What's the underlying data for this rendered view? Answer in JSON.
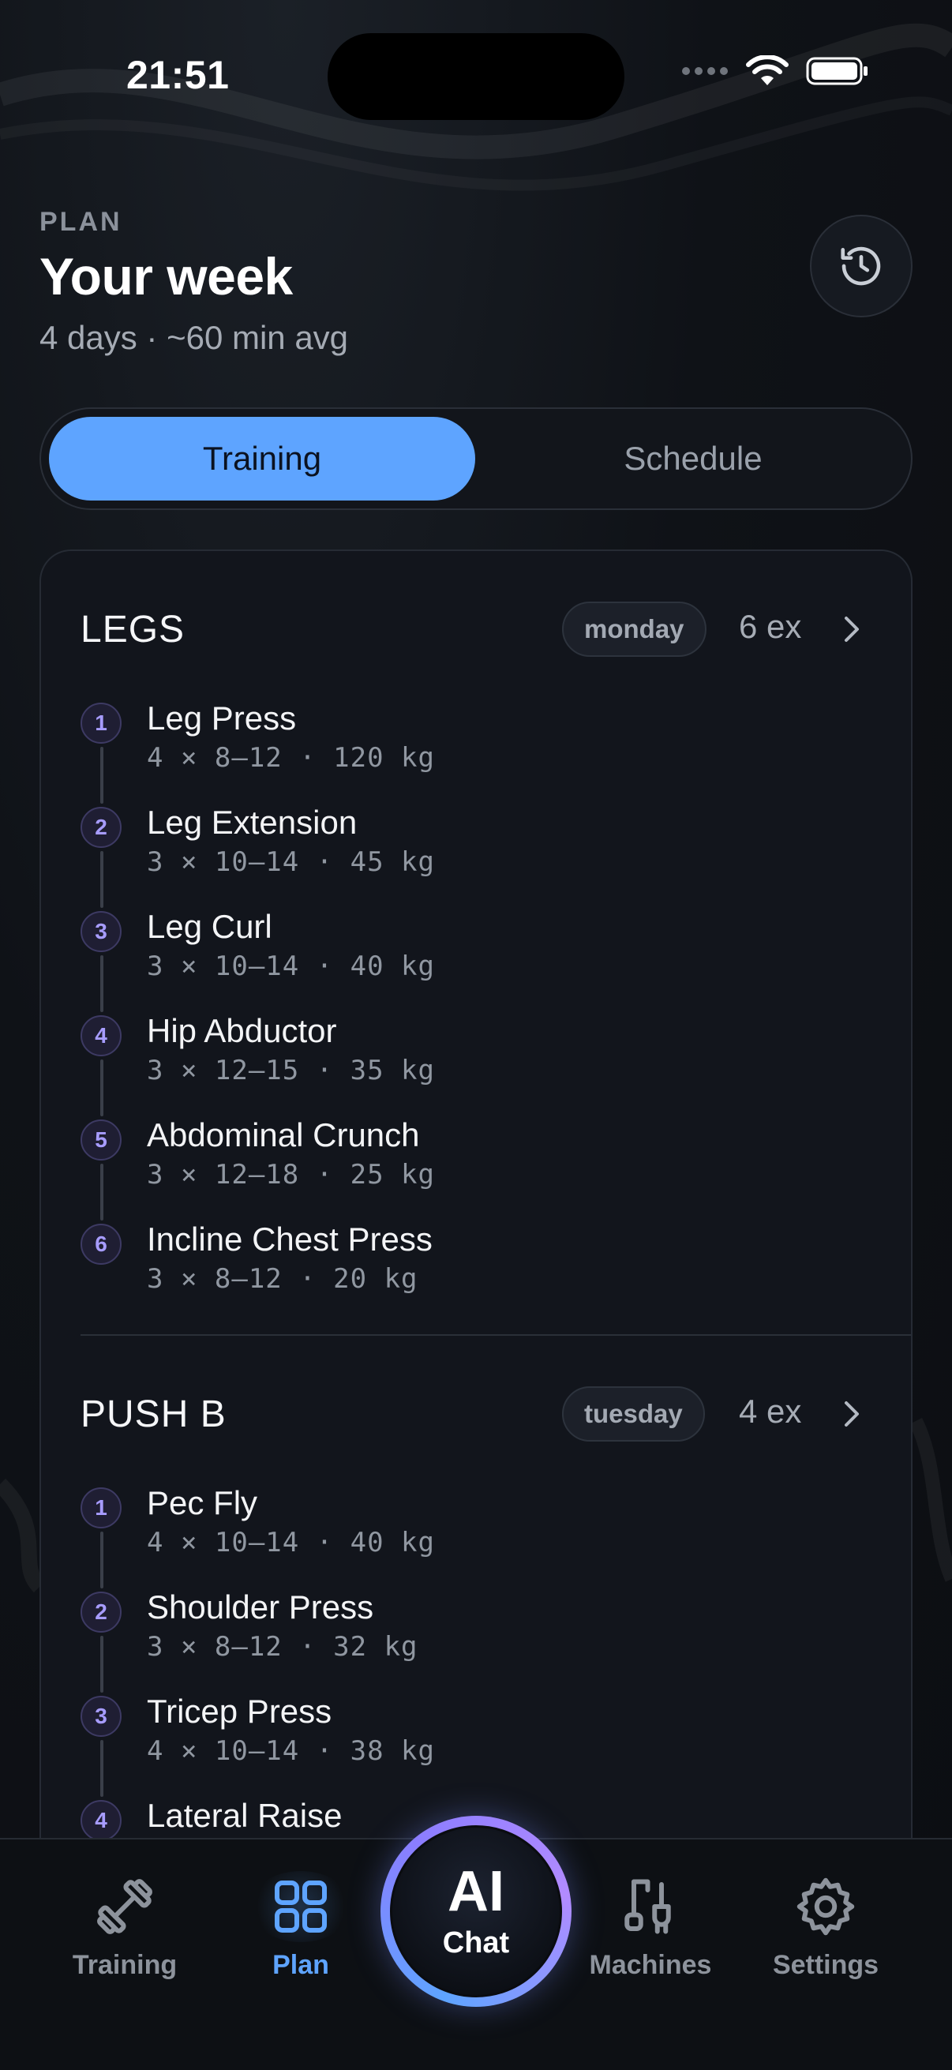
{
  "status": {
    "time": "21:51"
  },
  "header": {
    "eyebrow": "PLAN",
    "title": "Your week",
    "subtitle": "4 days · ~60 min avg"
  },
  "segment": {
    "active": "Training",
    "inactive": "Schedule"
  },
  "days": [
    {
      "name": "LEGS",
      "badge": "monday",
      "count": "6 ex",
      "exercises": [
        {
          "num": "1",
          "name": "Leg Press",
          "meta": "4 × 8–12 · 120 kg"
        },
        {
          "num": "2",
          "name": "Leg Extension",
          "meta": "3 × 10–14 · 45 kg"
        },
        {
          "num": "3",
          "name": "Leg Curl",
          "meta": "3 × 10–14 · 40 kg"
        },
        {
          "num": "4",
          "name": "Hip Abductor",
          "meta": "3 × 12–15 · 35 kg"
        },
        {
          "num": "5",
          "name": "Abdominal Crunch",
          "meta": "3 × 12–18 · 25 kg"
        },
        {
          "num": "6",
          "name": "Incline Chest Press",
          "meta": "3 × 8–12 · 20 kg"
        }
      ]
    },
    {
      "name": "PUSH B",
      "badge": "tuesday",
      "count": "4 ex",
      "exercises": [
        {
          "num": "1",
          "name": "Pec Fly",
          "meta": "4 × 10–14 · 40 kg"
        },
        {
          "num": "2",
          "name": "Shoulder Press",
          "meta": "3 × 8–12 · 32 kg"
        },
        {
          "num": "3",
          "name": "Tricep Press",
          "meta": "4 × 10–14 · 38 kg"
        },
        {
          "num": "4",
          "name": "Lateral Raise",
          "meta": ""
        }
      ]
    }
  ],
  "nav": {
    "training": "Training",
    "plan": "Plan",
    "ai_big": "AI",
    "ai_small": "Chat",
    "machines": "Machines",
    "settings": "Settings"
  },
  "colors": {
    "accent": "#5ea4ff",
    "number_accent": "#a79cff"
  },
  "icons": {
    "history": "history-clock-icon",
    "training": "dumbbell-icon",
    "plan": "grid-icon",
    "machines": "cable-machine-icon",
    "settings": "gear-icon"
  }
}
